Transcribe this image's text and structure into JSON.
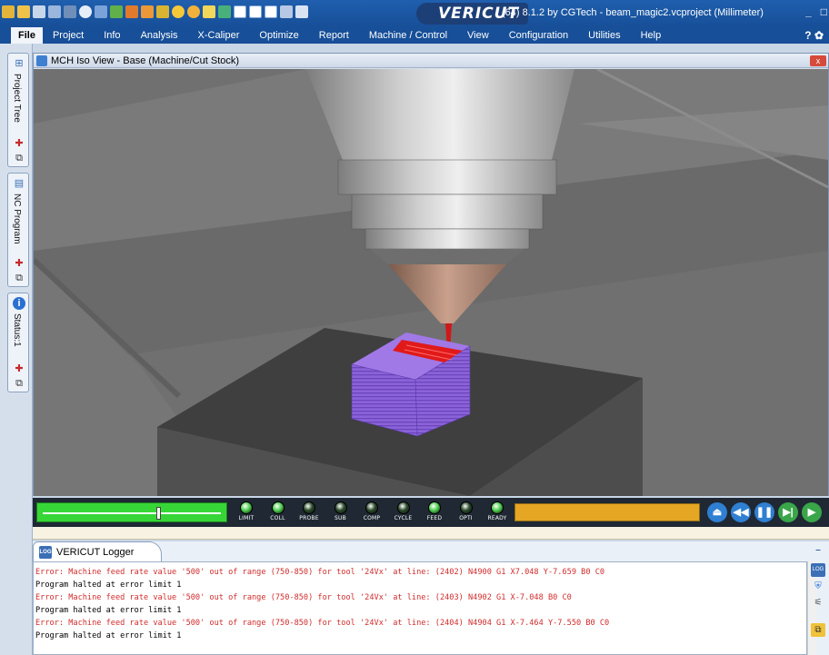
{
  "app": {
    "logo": "VERICUT",
    "title": "(64) 8.1.2 by CGTech - beam_magic2.vcproject (Millimeter)",
    "window_controls": [
      "_",
      "□"
    ]
  },
  "menu": {
    "items": [
      "File",
      "Project",
      "Info",
      "Analysis",
      "X-Caliper",
      "Optimize",
      "Report",
      "Machine / Control",
      "View",
      "Configuration",
      "Utilities",
      "Help"
    ],
    "right_icons": "? ✿"
  },
  "dock": {
    "tabs": [
      {
        "label": "Project Tree",
        "icon": "tree-icon"
      },
      {
        "label": "NC Program",
        "icon": "nc-program-icon"
      },
      {
        "label": "Status:1",
        "icon": "info-icon"
      }
    ]
  },
  "view": {
    "title": "MCH Iso View - Base (Machine/Cut Stock)",
    "close": "x"
  },
  "controlbar": {
    "slider_fraction": 0.64,
    "leds": [
      {
        "label": "LIMIT",
        "color": "#4fd14f"
      },
      {
        "label": "COLL",
        "color": "#4fd14f"
      },
      {
        "label": "PROBE",
        "color": "#2a4a2a"
      },
      {
        "label": "SUB",
        "color": "#2a4a2a"
      },
      {
        "label": "COMP",
        "color": "#2a4a2a"
      },
      {
        "label": "CYCLE",
        "color": "#2a4a2a"
      },
      {
        "label": "FEED",
        "color": "#4fd14f"
      },
      {
        "label": "OPTI",
        "color": "#2a4a2a"
      },
      {
        "label": "READY",
        "color": "#4fd14f"
      }
    ],
    "playback": [
      "eject-icon",
      "rewind-icon",
      "pause-icon",
      "step-icon",
      "play-icon"
    ]
  },
  "logger": {
    "tab_label": "VERICUT Logger",
    "lines": [
      {
        "type": "err",
        "text": "Error: Machine feed rate value '500' out of range (750-850) for tool '24Vx' at line: (2402) N4900 G1 X7.048 Y-7.659 B0 C0"
      },
      {
        "type": "ok",
        "text": "Program halted at error limit 1"
      },
      {
        "type": "err",
        "text": "Error: Machine feed rate value '500' out of range (750-850) for tool '24Vx' at line: (2403) N4902 G1 X-7.048 B0 C0"
      },
      {
        "type": "ok",
        "text": "Program halted at error limit 1"
      },
      {
        "type": "err",
        "text": "Error: Machine feed rate value '500' out of range (750-850) for tool '24Vx' at line: (2404) N4904 G1 X-7.464 Y-7.550 B0 C0"
      },
      {
        "type": "ok",
        "text": "Program halted at error limit 1"
      }
    ]
  }
}
